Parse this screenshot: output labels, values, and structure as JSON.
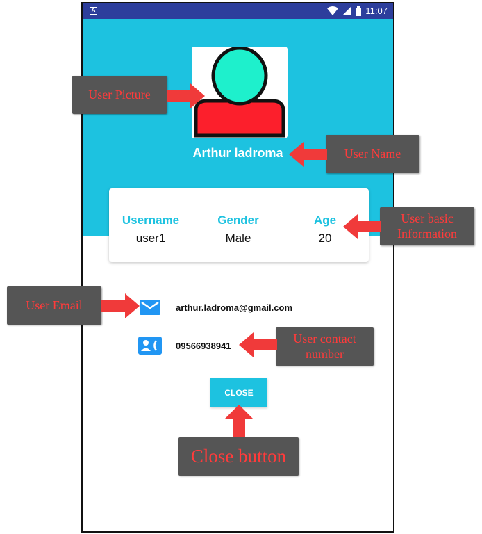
{
  "status_bar": {
    "time": "11:07",
    "icons": [
      "notification-icon",
      "wifi-icon",
      "signal-icon",
      "battery-icon"
    ]
  },
  "profile": {
    "name": "Arthur ladroma",
    "picture_icon": "user-avatar-icon"
  },
  "info_card": {
    "columns": [
      {
        "label": "Username",
        "value": "user1"
      },
      {
        "label": "Gender",
        "value": "Male"
      },
      {
        "label": "Age",
        "value": "20"
      }
    ]
  },
  "contact": {
    "email": "arthur.ladroma@gmail.com",
    "phone": "09566938941",
    "email_icon": "email-icon",
    "phone_icon": "contact-card-icon"
  },
  "close_button": {
    "label": "CLOSE"
  },
  "annotations": {
    "user_picture": "User Picture",
    "user_name": "User Name",
    "user_basic_information_line1": "User basic",
    "user_basic_information_line2": "Information",
    "user_email": "User Email",
    "user_contact_line1": "User contact",
    "user_contact_line2": "number",
    "close_button": "Close button"
  },
  "colors": {
    "header_blue": "#1dc2e0",
    "status_bar": "#2d3e9c",
    "accent_icon": "#2196f3",
    "callout_bg": "#555555",
    "callout_text": "#ff3b3b",
    "arrow_red": "#f03a3a"
  }
}
